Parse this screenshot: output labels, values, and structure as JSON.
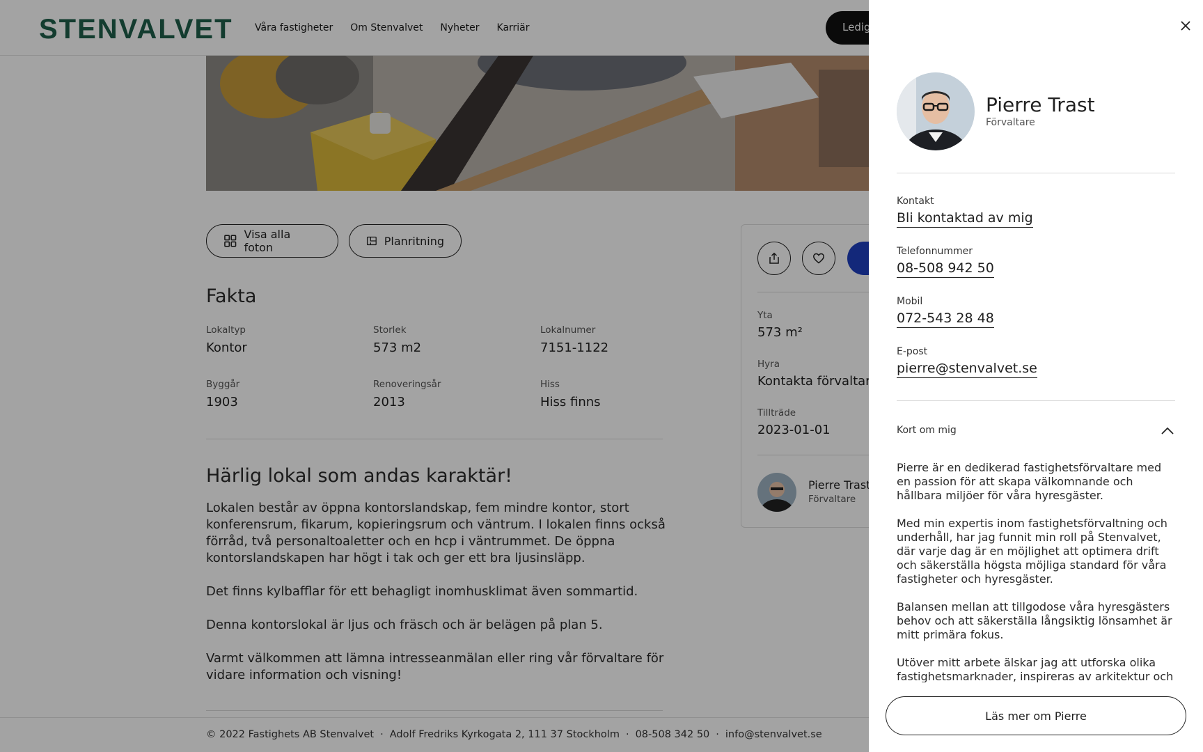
{
  "header": {
    "logo": "STENVALVET",
    "nav": [
      "Våra fastigheter",
      "Om Stenvalvet",
      "Nyheter",
      "Karriär"
    ],
    "cta_label": "Ledig"
  },
  "gallery": {
    "all_photos_label": "Visa alla foton",
    "floorplan_label": "Planritning"
  },
  "facts": {
    "title": "Fakta",
    "items": [
      {
        "label": "Lokaltyp",
        "value": "Kontor"
      },
      {
        "label": "Storlek",
        "value": "573 m2"
      },
      {
        "label": "Lokalnumer",
        "value": "7151-1122"
      },
      {
        "label": "Byggår",
        "value": "1903"
      },
      {
        "label": "Renoveringsår",
        "value": "2013"
      },
      {
        "label": "Hiss",
        "value": "Hiss finns"
      }
    ]
  },
  "description": {
    "title": "Härlig lokal som andas karaktär!",
    "paragraphs": [
      "Lokalen består av öppna kontorslandskap, fem mindre kontor, stort konferensrum, fikarum, kopieringsrum och väntrum. I lokalen finns också förråd, två personaltoaletter och en hcp i väntrummet. De öppna kontorslandskapen har högt i tak och ger ett bra ljusinsläpp.",
      "Det finns kylbafflar för ett behagligt inomhusklimat även sommartid.",
      "Denna kontorslokal är ljus och fräsch och är belägen på plan 5.",
      "Varmt välkommen att lämna intresseanmälan eller ring vår förvaltare för vidare information och visning!"
    ]
  },
  "summary_card": {
    "area_label": "Yta",
    "area_value": "573 m²",
    "rent_label": "Hyra",
    "rent_value": "Kontakta förvaltar",
    "access_label": "Tillträde",
    "access_value": "2023-01-01",
    "manager_name": "Pierre Trast",
    "manager_role": "Förvaltare"
  },
  "footer": {
    "copyright": "© 2022 Fastighets AB Stenvalvet",
    "address": "Adolf Fredriks Kyrkogata 2, 111 37 Stockholm",
    "phone": "08-508 342 50",
    "email": "info@stenvalvet.se",
    "separator": "·"
  },
  "panel": {
    "name": "Pierre Trast",
    "role": "Förvaltare",
    "contact_label": "Kontakt",
    "contact_link": "Bli kontaktad av mig",
    "phone_label": "Telefonnummer",
    "phone": "08-508 942 50",
    "mobile_label": "Mobil",
    "mobile": "072-543 28 48",
    "email_label": "E-post",
    "email": "pierre@stenvalvet.se",
    "about_title": "Kort om mig",
    "about_paragraphs": [
      "Pierre är en dedikerad fastighetsförvaltare med en passion för att skapa välkomnande och hållbara miljöer för våra hyresgäster.",
      "Med min expertis inom fastighetsförvaltning och underhåll, har jag funnit min roll på Stenvalvet, där varje dag är en möjlighet att optimera drift och säkerställa högsta möjliga standard för våra fastigheter och hyresgäster.",
      "Balansen mellan att tillgodose våra hyresgästers behov och att säkerställa långsiktig lönsamhet är mitt primära fokus.",
      "Utöver mitt arbete älskar jag att utforska olika fastighetsmarknader, inspireras av arkitektur och"
    ],
    "more_label": "Läs mer om Pierre"
  },
  "icons": {
    "grid": "grid-icon",
    "floorplan": "floorplan-icon",
    "share": "share-icon",
    "heart": "heart-icon",
    "close": "close-icon",
    "chevron": "chevron-up-icon"
  },
  "colors": {
    "brand": "#1e5e4a",
    "primary_button": "#1f3fbf",
    "overlay": "rgba(0,0,0,0.36)"
  }
}
